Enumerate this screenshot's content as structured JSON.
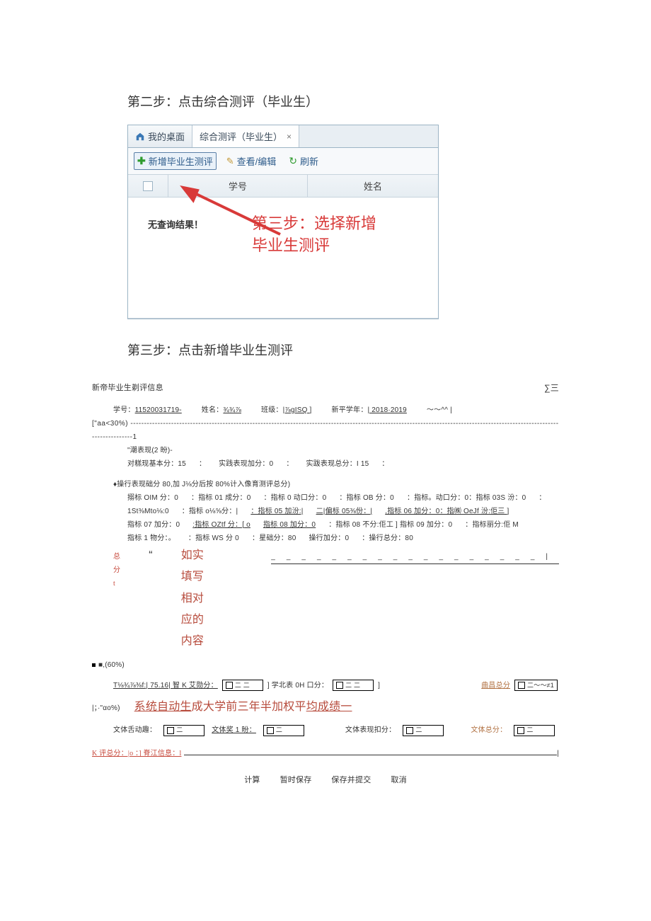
{
  "steps": {
    "step2_title": "第二步：点击综合测评（毕业生）",
    "step3_title": "第三步：点击新增毕业生测评",
    "callout_line1": "第三步：选择新增",
    "callout_line2": "毕业生测评"
  },
  "tabs": {
    "desktop": "我的桌面",
    "assessment": "综合测评（毕业生）"
  },
  "toolbar": {
    "add": "新增毕业生测评",
    "view": "查看/编辑",
    "refresh": "刷新"
  },
  "grid": {
    "col_sn": "学号",
    "col_name": "姓名",
    "no_result": "无查询结果！"
  },
  "form": {
    "title": "新帝毕业生剃评信息",
    "sigma": "∑三",
    "info": {
      "sn_label": "学号：",
      "sn_value": "11520031719-",
      "name_label": "姓名：",
      "name_value": "¾¾⅞",
      "class_label": "班级：",
      "class_value": "|⅞gISQ ]",
      "year_label": "新平学年：",
      "year_value": "| 2018·2019",
      "tail": "～～^^ |"
    },
    "section_aa": "[\"aa<30%) -----------------------------------------------------------------------------------------------------------------------------------------------------------------------------1",
    "sub_2": "\"潮表现(2 昐)-",
    "rows": {
      "r1a": "对糕现基本分：15",
      "r1b": "：",
      "r1c": "实践表现加分：0",
      "r1d": "：",
      "r1e": "实跋表现总分：I 15",
      "r1f": "：",
      "sub_ops": "♦操行表现础分 80,加 J⅛分后按 80%计入像育测评总分)",
      "r2a": "搦标 OIM 分：0 ",
      "r2b": "：指标 01 成分：0",
      "r2c": "：指标 0 动口分：0",
      "r2d": "：指标 OB 分：0",
      "r2e": "：指标。动口分：0：指标 03S 汾：0",
      "r2f": "：",
      "r3a": "1St⅜Mto⅛:0",
      "r3b": "：指标 o⅛⅝分：|",
      "r3c": "：指标 05 加汾:|",
      "r3d": "二|偏标 05⅜份：|",
      "r3e": ",指标 06 加分：0：指㈱ OeJf 汾:佢三 ]",
      "r4a": "指标 07 加分：0",
      "r4b": ":指标 OZtf 分：[ o",
      "r4c": "指标 08 加分：0",
      "r4d": "：指标 08 不分:佢工 ] 指标 09 加分：0",
      "r4e": "：指标丽分:佢 M",
      "r5a": "指标 1 物分：。",
      "r5b": "：指标 WS 分 0",
      "r5c": "：星础分：80",
      "r5d": "操行加分：0",
      "r5e": "：操行总分：80",
      "total_label": "总分t",
      "total_quote": "“",
      "note_fill": "如实填写相对应的内容",
      "section_60": "■,(60%)",
      "t_row_a": "T⅛¾⅞⅜f:| 75.16| 智 K 艾勋分：",
      "t_row_b": "]  学北表 0H 口分：",
      "t_row_c": "]",
      "qu_total": "曲昌总分",
      "qu_tail": "～～≠1",
      "ao_label": "|；·\"αo%)",
      "note_auto": "系统自动生",
      "note_auto2": "成大学前三年半加权平",
      "note_auto3": "均成绩一",
      "wt_a": "文体舌动趣：",
      "wt_b": "文体奖 1 昐：",
      "wt_c": "文体表现扣分：",
      "wt_d": "文体总分：",
      "k_total": "K 评总分：|o            ：]  脊江信息：l",
      "buttons": {
        "calc": "计算",
        "save_tmp": "暂时保存",
        "submit": "保存并提交",
        "cancel": "取消"
      }
    }
  }
}
